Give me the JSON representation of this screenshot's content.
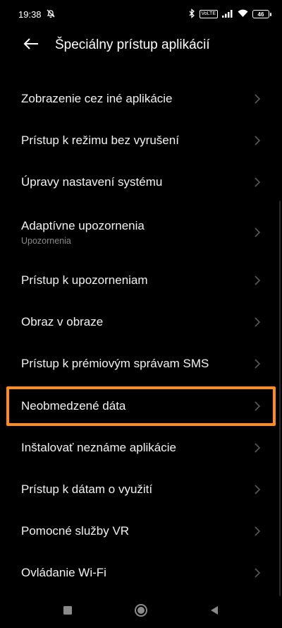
{
  "status_bar": {
    "time": "19:38",
    "battery": "46",
    "network_badge": "VoLTE"
  },
  "header": {
    "title": "Špeciálny prístup aplikácií"
  },
  "items": [
    {
      "label": "Zobrazenie cez iné aplikácie"
    },
    {
      "label": "Prístup k režimu bez vyrušení"
    },
    {
      "label": "Úpravy nastavení systému"
    },
    {
      "label": "Adaptívne upozornenia",
      "subtitle": "Upozornenia"
    },
    {
      "label": "Prístup k upozorneniam"
    },
    {
      "label": "Obraz v obraze"
    },
    {
      "label": "Prístup k prémiovým správam SMS"
    },
    {
      "label": "Neobmedzené dáta"
    },
    {
      "label": "Inštalovať neznáme aplikácie"
    },
    {
      "label": "Prístup k dátam o využití"
    },
    {
      "label": "Pomocné služby VR"
    },
    {
      "label": "Ovládanie Wi-Fi"
    }
  ],
  "colors": {
    "background": "#000000",
    "highlight": "#ff8c1a",
    "chevron": "#5a5a5a"
  }
}
